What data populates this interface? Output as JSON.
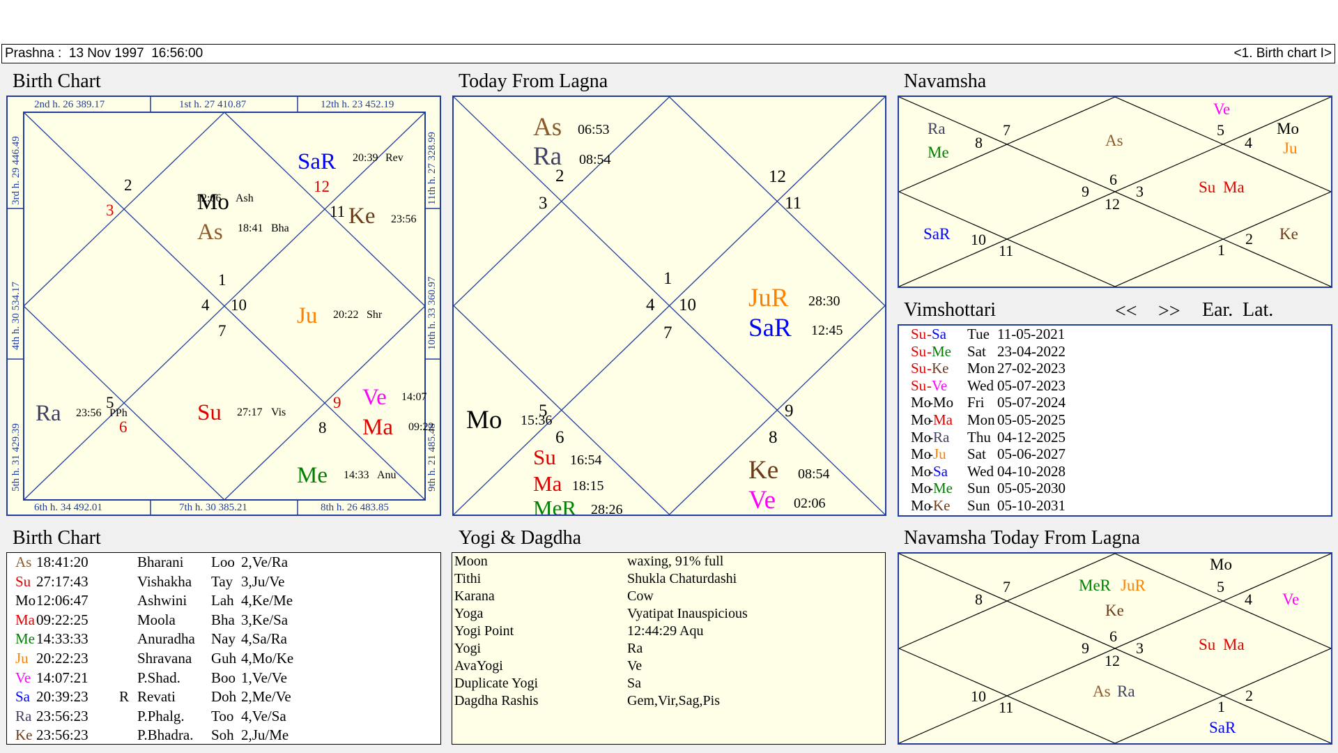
{
  "header": {
    "left": "Prashna :  13 Nov 1997  16:56:00",
    "right": "<1. Birth chart I>"
  },
  "titles": {
    "birth_chart": "Birth Chart",
    "today_from_lagna": "Today From Lagna",
    "navamsha": "Navamsha",
    "vimshottari": "Vimshottari",
    "birth_chart_table": "Birth Chart",
    "yogi_dagdha": "Yogi & Dagdha",
    "navamsha_today": "Navamsha Today From Lagna"
  },
  "vim_nav": {
    "prev": "<<",
    "next": ">>",
    "ear": "Ear.",
    "lat": "Lat."
  },
  "colors": {
    "Su": "#e00000",
    "Mo": "#000000",
    "Ma": "#e00000",
    "Me": "#008000",
    "Ju": "#ff7f00",
    "Ve": "#ff00ff",
    "Sa": "#0000ff",
    "Ra": "#404060",
    "Ke": "#6a3a1a",
    "As": "#8b5a2b",
    "sign": "#e00000",
    "border": "#1f3c9e"
  },
  "birth_chart": {
    "houses": {
      "top": [
        {
          "text": "2nd h.  26  389.17"
        },
        {
          "text": "1st h.  27  410.87"
        },
        {
          "text": "12th h.  23  452.19"
        }
      ],
      "bottom": [
        {
          "text": "6th h.  34  492.01"
        },
        {
          "text": "7th h.  30  385.21"
        },
        {
          "text": "8th h.  26  483.85"
        }
      ],
      "left": [
        {
          "text": "3rd h.  29  446.49"
        },
        {
          "text": "4th h.  30  534.17"
        },
        {
          "text": "5th h.  31  429.39"
        }
      ],
      "right": [
        {
          "text": "11th h.  27  328.99"
        },
        {
          "text": "10th h.  33  360.97"
        },
        {
          "text": "9th h.  21  485.48"
        }
      ]
    },
    "signs": [
      "2",
      "3",
      "12",
      "11",
      "1",
      "4",
      "10",
      "7",
      "5",
      "6",
      "9",
      "8"
    ],
    "planets": [
      {
        "name": "Mo",
        "color": "Mo",
        "time": "12:06",
        "nak": "Ash"
      },
      {
        "name": "As",
        "color": "As",
        "time": "18:41",
        "nak": "Bha"
      },
      {
        "name": "SaR",
        "color": "Sa",
        "time": "20:39",
        "nak": "Rev"
      },
      {
        "name": "Ke",
        "color": "Ke",
        "time": "23:56",
        "nak": ""
      },
      {
        "name": "Ju",
        "color": "Ju",
        "time": "20:22",
        "nak": "Shr"
      },
      {
        "name": "Ra",
        "color": "Ra",
        "time": "23:56",
        "nak": "PPh"
      },
      {
        "name": "Su",
        "color": "Su",
        "time": "27:17",
        "nak": "Vis"
      },
      {
        "name": "Ve",
        "color": "Ve",
        "time": "14:07",
        "nak": ""
      },
      {
        "name": "Ma",
        "color": "Ma",
        "time": "09:22",
        "nak": ""
      },
      {
        "name": "Me",
        "color": "Me",
        "time": "14:33",
        "nak": "Anu"
      }
    ]
  },
  "today": {
    "signs": [
      "2",
      "3",
      "12",
      "11",
      "1",
      "4",
      "10",
      "7",
      "5",
      "6",
      "9",
      "8"
    ],
    "planets": [
      {
        "name": "As",
        "color": "As",
        "time": "06:53"
      },
      {
        "name": "Ra",
        "color": "Ra",
        "time": "08:54"
      },
      {
        "name": "JuR",
        "color": "Ju",
        "time": "28:30"
      },
      {
        "name": "SaR",
        "color": "Sa",
        "time": "12:45"
      },
      {
        "name": "Mo",
        "color": "Mo",
        "time": "15:36"
      },
      {
        "name": "Su",
        "color": "Su",
        "time": "16:54"
      },
      {
        "name": "Ma",
        "color": "Ma",
        "time": "18:15"
      },
      {
        "name": "MeR",
        "color": "Me",
        "time": "28:26"
      },
      {
        "name": "Ke",
        "color": "Ke",
        "time": "08:54"
      },
      {
        "name": "Ve",
        "color": "Ve",
        "time": "02:06"
      }
    ]
  },
  "navamsha": {
    "signs": [
      "7",
      "8",
      "5",
      "4",
      "6",
      "9",
      "3",
      "12",
      "10",
      "11",
      "2",
      "1"
    ],
    "planets": [
      {
        "name": "Ve",
        "color": "Ve"
      },
      {
        "name": "Ra",
        "color": "Ra"
      },
      {
        "name": "Me",
        "color": "Me"
      },
      {
        "name": "As",
        "color": "As"
      },
      {
        "name": "Mo",
        "color": "Mo"
      },
      {
        "name": "Ju",
        "color": "Ju"
      },
      {
        "name": "Su",
        "color": "Su"
      },
      {
        "name": "Ma",
        "color": "Ma"
      },
      {
        "name": "SaR",
        "color": "Sa"
      },
      {
        "name": "Ke",
        "color": "Ke"
      }
    ]
  },
  "navamsha_today": {
    "signs": [
      "7",
      "8",
      "5",
      "4",
      "6",
      "9",
      "3",
      "12",
      "10",
      "11",
      "2",
      "1"
    ],
    "planets": [
      {
        "name": "Mo",
        "color": "Mo"
      },
      {
        "name": "MeR",
        "color": "Me"
      },
      {
        "name": "JuR",
        "color": "Ju"
      },
      {
        "name": "Ke",
        "color": "Ke"
      },
      {
        "name": "Ve",
        "color": "Ve"
      },
      {
        "name": "Su",
        "color": "Su"
      },
      {
        "name": "Ma",
        "color": "Ma"
      },
      {
        "name": "As",
        "color": "As"
      },
      {
        "name": "Ra",
        "color": "Ra"
      },
      {
        "name": "SaR",
        "color": "Sa"
      }
    ]
  },
  "vimshottari": [
    {
      "a": "Su",
      "b": "Sa",
      "day": "Tue",
      "date": "11-05-2021"
    },
    {
      "a": "Su",
      "b": "Me",
      "day": "Sat",
      "date": "23-04-2022"
    },
    {
      "a": "Su",
      "b": "Ke",
      "day": "Mon",
      "date": "27-02-2023"
    },
    {
      "a": "Su",
      "b": "Ve",
      "day": "Wed",
      "date": "05-07-2023"
    },
    {
      "a": "Mo",
      "b": "Mo",
      "day": "Fri",
      "date": "05-07-2024"
    },
    {
      "a": "Mo",
      "b": "Ma",
      "day": "Mon",
      "date": "05-05-2025"
    },
    {
      "a": "Mo",
      "b": "Ra",
      "day": "Thu",
      "date": "04-12-2025"
    },
    {
      "a": "Mo",
      "b": "Ju",
      "day": "Sat",
      "date": "05-06-2027"
    },
    {
      "a": "Mo",
      "b": "Sa",
      "day": "Wed",
      "date": "04-10-2028"
    },
    {
      "a": "Mo",
      "b": "Me",
      "day": "Sun",
      "date": "05-05-2030"
    },
    {
      "a": "Mo",
      "b": "Ke",
      "day": "Sun",
      "date": "05-10-2031"
    }
  ],
  "planet_table": [
    {
      "p": "As",
      "deg": "18:41:20",
      "r": "",
      "nak": "Bharani",
      "pada": "Loo",
      "lord": "2,Ve/Ra"
    },
    {
      "p": "Su",
      "deg": "27:17:43",
      "r": "",
      "nak": "Vishakha",
      "pada": "Tay",
      "lord": "3,Ju/Ve"
    },
    {
      "p": "Mo",
      "deg": "12:06:47",
      "r": "",
      "nak": "Ashwini",
      "pada": "Lah",
      "lord": "4,Ke/Me"
    },
    {
      "p": "Ma",
      "deg": "09:22:25",
      "r": "",
      "nak": "Moola",
      "pada": "Bha",
      "lord": "3,Ke/Sa"
    },
    {
      "p": "Me",
      "deg": "14:33:33",
      "r": "",
      "nak": "Anuradha",
      "pada": "Nay",
      "lord": "4,Sa/Ra"
    },
    {
      "p": "Ju",
      "deg": "20:22:23",
      "r": "",
      "nak": "Shravana",
      "pada": "Guh",
      "lord": "4,Mo/Ke"
    },
    {
      "p": "Ve",
      "deg": "14:07:21",
      "r": "",
      "nak": "P.Shad.",
      "pada": "Boo",
      "lord": "1,Ve/Ve"
    },
    {
      "p": "Sa",
      "deg": "20:39:23",
      "r": "R",
      "nak": "Revati",
      "pada": "Doh",
      "lord": "2,Me/Ve"
    },
    {
      "p": "Ra",
      "deg": "23:56:23",
      "r": "",
      "nak": "P.Phalg.",
      "pada": "Too",
      "lord": "4,Ve/Sa"
    },
    {
      "p": "Ke",
      "deg": "23:56:23",
      "r": "",
      "nak": "P.Bhadra.",
      "pada": "Soh",
      "lord": "2,Ju/Me"
    }
  ],
  "yogi": [
    {
      "k": "Moon",
      "v": "waxing, 91% full"
    },
    {
      "k": "Tithi",
      "v": "Shukla  Chaturdashi"
    },
    {
      "k": "Karana",
      "v": "Cow"
    },
    {
      "k": "Yoga",
      "v": "Vyatipat Inauspicious"
    },
    {
      "k": "Yogi Point",
      "v": "12:44:29 Aqu"
    },
    {
      "k": "Yogi",
      "v": "Ra"
    },
    {
      "k": "AvaYogi",
      "v": "Ve"
    },
    {
      "k": "Duplicate Yogi",
      "v": "Sa"
    },
    {
      "k": "Dagdha Rashis",
      "v": "Gem,Vir,Sag,Pis"
    }
  ]
}
